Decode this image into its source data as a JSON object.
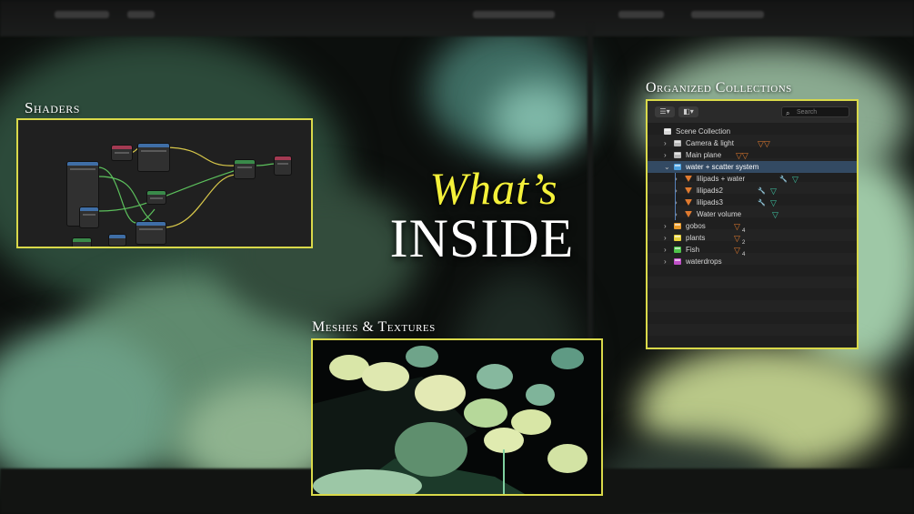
{
  "headline": {
    "line1": "What’s",
    "line2": "INSIDE"
  },
  "sections": {
    "shaders": "Shaders",
    "meshes": "Meshes & Textures",
    "collections": "Organized Collections"
  },
  "outliner": {
    "search_placeholder": "Search",
    "root": "Scene Collection",
    "items": [
      {
        "label": "Camera & light",
        "color": "#b8b8b8",
        "depth": 0,
        "expanded": false,
        "extras": "mesh-icons",
        "selected": false
      },
      {
        "label": "Main plane",
        "color": "#b8b8b8",
        "depth": 0,
        "expanded": false,
        "extras": "mesh-icons",
        "selected": false
      },
      {
        "label": "water + scatter system",
        "color": "#4fa3e0",
        "depth": 0,
        "expanded": true,
        "extras": "",
        "selected": true
      },
      {
        "label": "lilipads + water",
        "color": "#e07a2f",
        "depth": 1,
        "expanded": false,
        "extras": "modifier",
        "selected": false
      },
      {
        "label": "lilipads2",
        "color": "#e07a2f",
        "depth": 1,
        "expanded": false,
        "extras": "modifier",
        "selected": false
      },
      {
        "label": "lilipads3",
        "color": "#e07a2f",
        "depth": 1,
        "expanded": false,
        "extras": "modifier",
        "selected": false
      },
      {
        "label": "Water volume",
        "color": "#e07a2f",
        "depth": 1,
        "expanded": false,
        "extras": "material",
        "selected": false
      },
      {
        "label": "gobos",
        "color": "#e89a2a",
        "depth": 0,
        "expanded": false,
        "extras": "4",
        "selected": false
      },
      {
        "label": "plants",
        "color": "#e8d23a",
        "depth": 0,
        "expanded": false,
        "extras": "2",
        "selected": false
      },
      {
        "label": "Fish",
        "color": "#4ec24a",
        "depth": 0,
        "expanded": false,
        "extras": "4",
        "selected": false
      },
      {
        "label": "waterdrops",
        "color": "#c050c8",
        "depth": 0,
        "expanded": false,
        "extras": "",
        "selected": false
      }
    ]
  },
  "colors": {
    "frame": "#d9d94a",
    "accent": "#f4f13a"
  }
}
